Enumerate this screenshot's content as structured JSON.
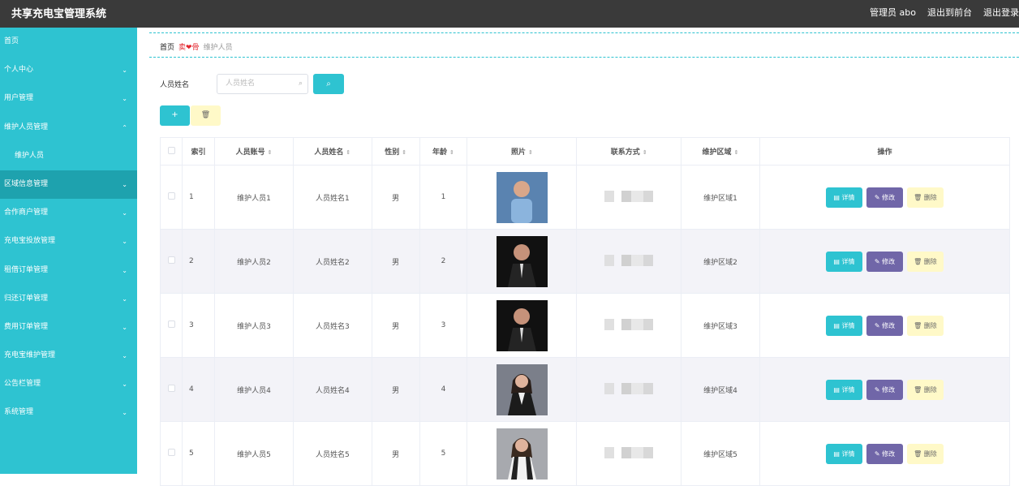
{
  "header": {
    "title": "共享充电宝管理系统",
    "admin": "管理员 abo",
    "back": "退出到前台",
    "logout": "退出登录"
  },
  "sidebar": {
    "items": [
      {
        "label": "首页",
        "arrow": ""
      },
      {
        "label": "个人中心",
        "arrow": "⌄"
      },
      {
        "label": "用户管理",
        "arrow": "⌄"
      },
      {
        "label": "维护人员管理",
        "arrow": "⌃"
      },
      {
        "label": "维护人员",
        "arrow": ""
      },
      {
        "label": "区域信息管理",
        "arrow": "⌄"
      },
      {
        "label": "合作商户管理",
        "arrow": "⌄"
      },
      {
        "label": "充电宝投放管理",
        "arrow": "⌄"
      },
      {
        "label": "租借订单管理",
        "arrow": "⌄"
      },
      {
        "label": "归还订单管理",
        "arrow": "⌄"
      },
      {
        "label": "费用订单管理",
        "arrow": "⌄"
      },
      {
        "label": "充电宝维护管理",
        "arrow": "⌄"
      },
      {
        "label": "公告栏管理",
        "arrow": "⌄"
      },
      {
        "label": "系统管理",
        "arrow": "⌄"
      }
    ]
  },
  "breadcrumb": {
    "home": "首页",
    "sep": "卖❤骨",
    "current": "维护人员"
  },
  "search": {
    "label": "人员姓名",
    "placeholder": "人员姓名",
    "icon": "⌕",
    "button_icon": "⌕"
  },
  "toolbar": {
    "add_icon": "+",
    "delete_icon": "🗑"
  },
  "table": {
    "headers": [
      "索引",
      "人员账号",
      "人员姓名",
      "性别",
      "年龄",
      "照片",
      "联系方式",
      "维护区域",
      "操作"
    ],
    "sort_icon": "⇕",
    "rows": [
      {
        "index": "1",
        "account": "维护人员1",
        "name": "人员姓名1",
        "gender": "男",
        "age": "1",
        "area": "维护区域1"
      },
      {
        "index": "2",
        "account": "维护人员2",
        "name": "人员姓名2",
        "gender": "男",
        "age": "2",
        "area": "维护区域2"
      },
      {
        "index": "3",
        "account": "维护人员3",
        "name": "人员姓名3",
        "gender": "男",
        "age": "3",
        "area": "维护区域3"
      },
      {
        "index": "4",
        "account": "维护人员4",
        "name": "人员姓名4",
        "gender": "男",
        "age": "4",
        "area": "维护区域4"
      },
      {
        "index": "5",
        "account": "维护人员5",
        "name": "人员姓名5",
        "gender": "男",
        "age": "5",
        "area": "维护区域5"
      }
    ],
    "actions": {
      "detail": "▤ 详情",
      "edit": "✎ 修改",
      "delete": "🗑 删除"
    }
  }
}
